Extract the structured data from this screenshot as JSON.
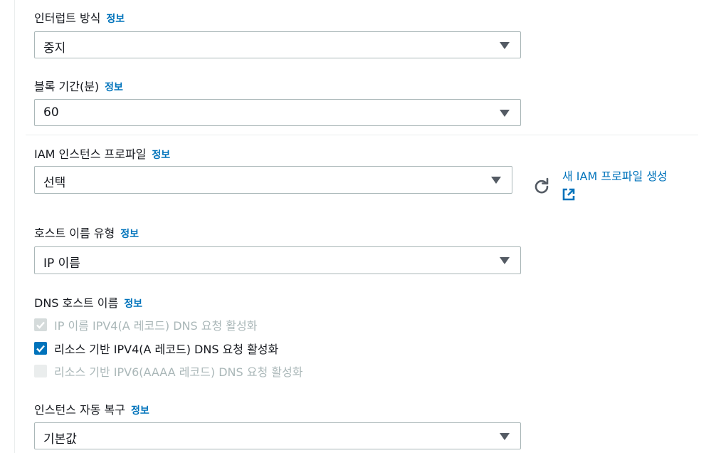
{
  "info_link": "정보",
  "interrupt": {
    "label": "인터럽트 방식",
    "value": "중지"
  },
  "block_duration": {
    "label": "블록 기간(분)",
    "value": "60"
  },
  "iam_profile": {
    "label": "IAM 인스턴스 프로파일",
    "value": "선택",
    "create_link": "새 IAM 프로파일 생성"
  },
  "hostname_type": {
    "label": "호스트 이름 유형",
    "value": "IP 이름"
  },
  "dns_hostname": {
    "label": "DNS 호스트 이름",
    "options": [
      {
        "label": "IP 이름 IPV4(A 레코드) DNS 요청 활성화",
        "checked": true,
        "disabled": true
      },
      {
        "label": "리소스 기반 IPV4(A 레코드) DNS 요청 활성화",
        "checked": true,
        "disabled": false
      },
      {
        "label": "리소스 기반 IPV6(AAAA 레코드) DNS 요청 활성화",
        "checked": false,
        "disabled": true
      }
    ]
  },
  "auto_recovery": {
    "label": "인스턴스 자동 복구",
    "value": "기본값"
  }
}
